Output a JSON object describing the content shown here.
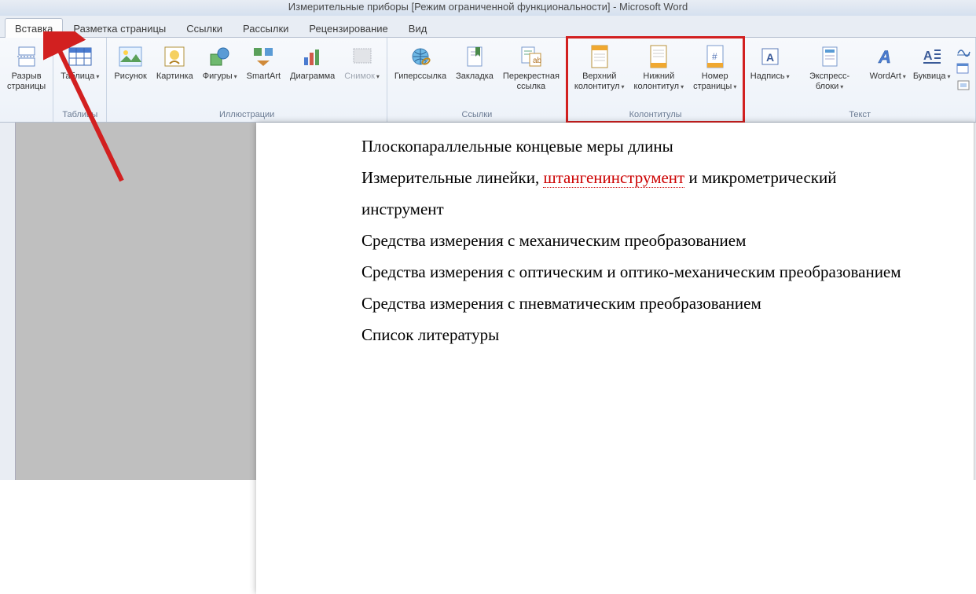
{
  "title": "Измерительные приборы [Режим ограниченной функциональности] - Microsoft Word",
  "tabs": {
    "insert": "Вставка",
    "layout": "Разметка страницы",
    "refs": "Ссылки",
    "mail": "Рассылки",
    "review": "Рецензирование",
    "view": "Вид"
  },
  "groups": {
    "pages": {
      "break": "Разрыв\nстраницы"
    },
    "tables": {
      "table": "Таблица",
      "label": "Таблицы"
    },
    "illus": {
      "picture": "Рисунок",
      "clipart": "Картинка",
      "shapes": "Фигуры",
      "smartart": "SmartArt",
      "chart": "Диаграмма",
      "screenshot": "Снимок",
      "label": "Иллюстрации"
    },
    "links": {
      "hyperlink": "Гиперссылка",
      "bookmark": "Закладка",
      "crossref": "Перекрестная\nссылка",
      "label": "Ссылки"
    },
    "hf": {
      "header": "Верхний\nколонтитул",
      "footer": "Нижний\nколонтитул",
      "pagenum": "Номер\nстраницы",
      "label": "Колонтитулы"
    },
    "text": {
      "textbox": "Надпись",
      "quickparts": "Экспресс-блоки",
      "wordart": "WordArt",
      "dropcap": "Буквица",
      "label": "Текст"
    }
  },
  "doc": {
    "l1": "Плоскопараллельные концевые меры длины",
    "l2a": "Измерительные линейки, ",
    "l2b": "штангенинструмент",
    "l2c": " и микрометрический",
    "l3": "инструмент",
    "l4": "Средства измерения с механическим преобразованием",
    "l5": "Средства измерения с оптическим и оптико-механическим преобразованием",
    "l6": "Средства измерения с пневматическим преобразованием",
    "l7": "Список литературы"
  }
}
